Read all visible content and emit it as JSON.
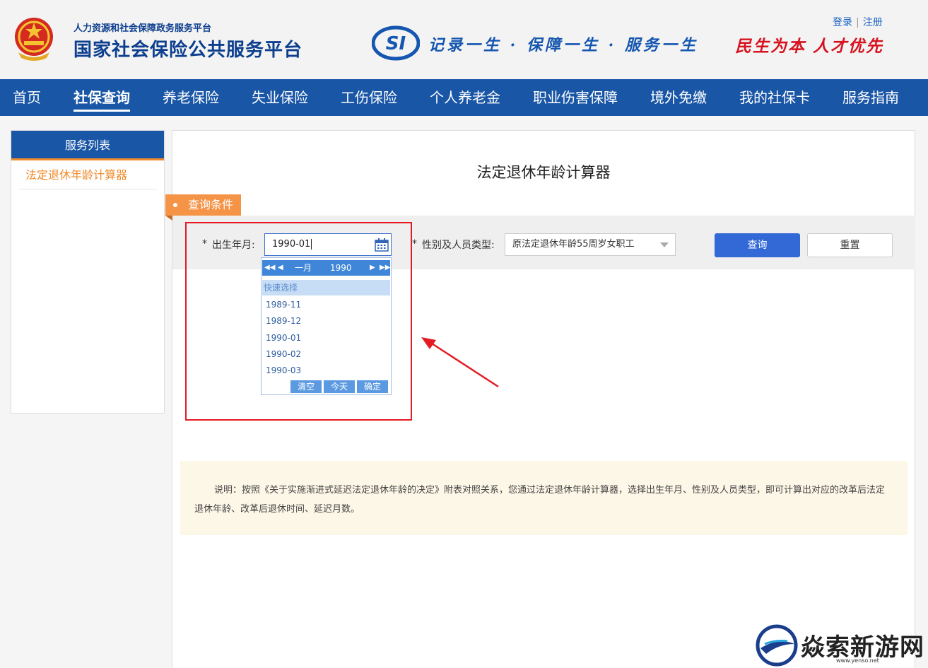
{
  "header": {
    "org_subtitle": "人力资源和社会保障政务服务平台",
    "org_title": "国家社会保险公共服务平台",
    "slogan": "记录一生 · 保障一生 · 服务一生",
    "motto": "民生为本 人才优先",
    "login": "登录",
    "register": "注册",
    "separator": "|"
  },
  "nav": {
    "items": [
      "首页",
      "社保查询",
      "养老保险",
      "失业保险",
      "工伤保险",
      "个人养老金",
      "职业伤害保障",
      "境外免缴",
      "我的社保卡",
      "服务指南"
    ],
    "active": "社保查询"
  },
  "sidebar": {
    "title": "服务列表",
    "items": [
      {
        "label": "法定退休年龄计算器"
      }
    ]
  },
  "main": {
    "title": "法定退休年龄计算器",
    "query_tag": "查询条件",
    "required_mark": "*",
    "birth_label": "出生年月:",
    "birth_value": "1990-01",
    "type_label": "性别及人员类型:",
    "type_value": "原法定退休年龄55周岁女职工",
    "query_button": "查询",
    "reset_button": "重置"
  },
  "datepicker": {
    "month": "一月",
    "year": "1990",
    "quick_select_label": "快速选择",
    "quick_options": [
      "1989-11",
      "1989-12",
      "1990-01",
      "1990-02",
      "1990-03"
    ],
    "clear": "清空",
    "today": "今天",
    "confirm": "确定"
  },
  "note": {
    "text": "说明：按照《关于实施渐进式延迟法定退休年龄的决定》附表对照关系，您通过法定退休年龄计算器，选择出生年月、性别及人员类型，即可计算出对应的改革后法定退休年龄、改革后退休时间、延迟月数。"
  },
  "watermark": {
    "text": "焱索新游网",
    "url": "www.yenso.net"
  },
  "colors": {
    "nav_bg": "#1a56a6",
    "accent_orange": "#f08a2a",
    "primary_button": "#3369d6",
    "annotation_red": "#e31b23"
  }
}
